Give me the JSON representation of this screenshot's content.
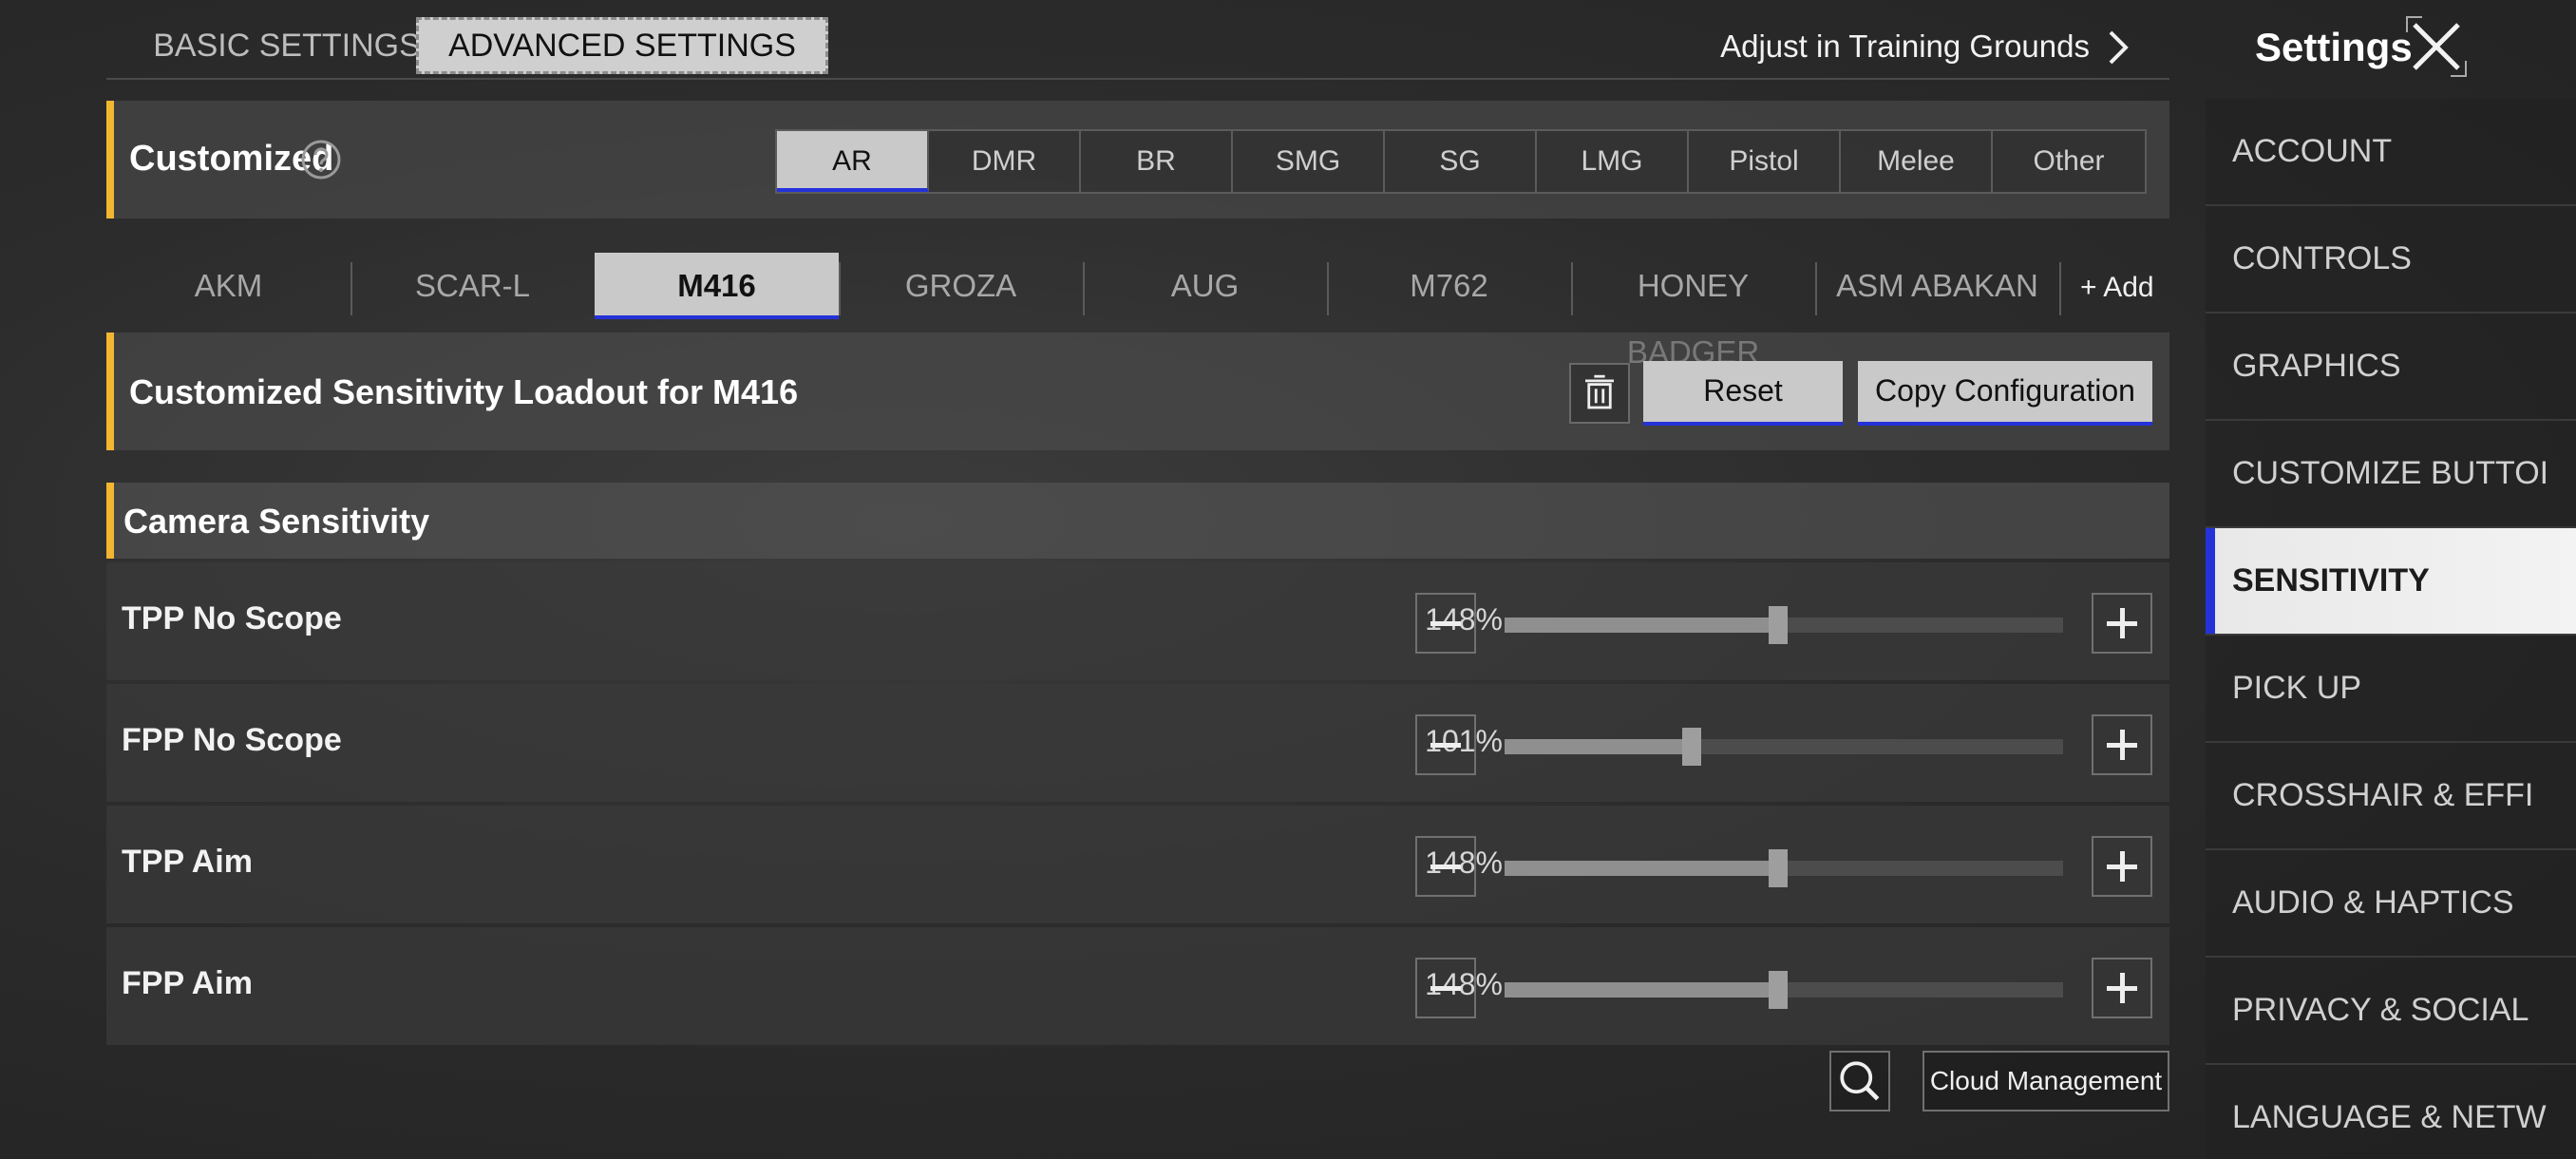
{
  "top_tabs": [
    {
      "label": "BASIC SETTINGS",
      "active": false
    },
    {
      "label": "ADVANCED SETTINGS",
      "active": true
    }
  ],
  "training_link": "Adjust in Training Grounds",
  "sidebar": {
    "title": "Settings",
    "items": [
      {
        "label": "ACCOUNT",
        "active": false
      },
      {
        "label": "CONTROLS",
        "active": false
      },
      {
        "label": "GRAPHICS",
        "active": false
      },
      {
        "label": "CUSTOMIZE BUTTOI",
        "active": false
      },
      {
        "label": "SENSITIVITY",
        "active": true
      },
      {
        "label": "PICK UP",
        "active": false
      },
      {
        "label": "CROSSHAIR & EFFI",
        "active": false
      },
      {
        "label": "AUDIO & HAPTICS",
        "active": false
      },
      {
        "label": "PRIVACY & SOCIAL",
        "active": false
      },
      {
        "label": "LANGUAGE & NETW",
        "active": false
      }
    ]
  },
  "customized": {
    "label": "Customized",
    "categories": [
      "AR",
      "DMR",
      "BR",
      "SMG",
      "SG",
      "LMG",
      "Pistol",
      "Melee",
      "Other"
    ],
    "selected_category": "AR"
  },
  "weapons": {
    "items": [
      "AKM",
      "SCAR-L",
      "M416",
      "GROZA",
      "AUG",
      "M762",
      "HONEY BADGER",
      "ASM ABAKAN"
    ],
    "selected": "M416",
    "add_label": "Add"
  },
  "loadout": {
    "label": "Customized Sensitivity Loadout for M416",
    "reset_label": "Reset",
    "copy_label": "Copy Configuration"
  },
  "camera": {
    "label": "Camera Sensitivity",
    "rows": [
      {
        "name": "TPP No Scope",
        "value": "148%",
        "level": 0.49
      },
      {
        "name": "FPP No Scope",
        "value": "101%",
        "level": 0.335
      },
      {
        "name": "TPP Aim",
        "value": "148%",
        "level": 0.49
      },
      {
        "name": "FPP Aim",
        "value": "148%",
        "level": 0.49
      }
    ]
  },
  "footer": {
    "cloud_label": "Cloud Management"
  },
  "colors": {
    "accent": "#f2b632",
    "selected_underline": "#2432d8"
  }
}
